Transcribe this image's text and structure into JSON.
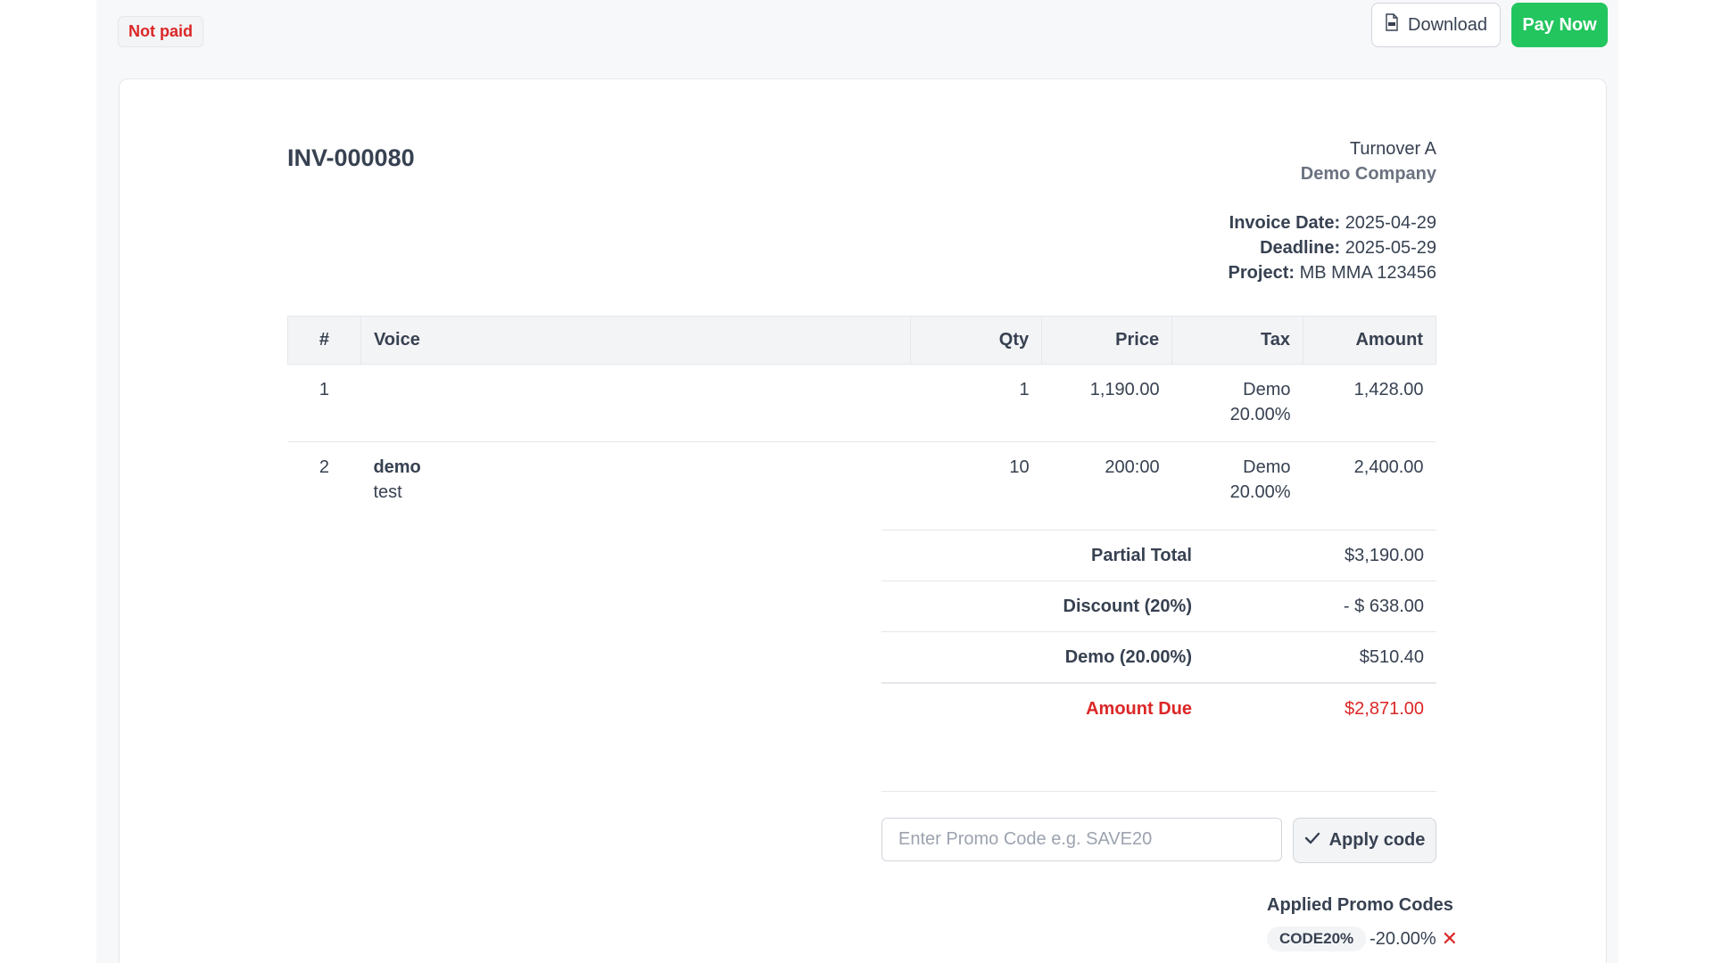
{
  "status_badge": "Not paid",
  "actions": {
    "download_label": "Download",
    "pay_label": "Pay Now"
  },
  "invoice": {
    "number": "INV-000080",
    "company_name": "Turnover A",
    "company_org": "Demo Company",
    "invoice_date_label": "Invoice Date:",
    "invoice_date": "2025-04-29",
    "deadline_label": "Deadline:",
    "deadline": "2025-05-29",
    "project_label": "Project:",
    "project": "MB MMA 123456"
  },
  "table": {
    "headers": [
      "#",
      "Voice",
      "Qty",
      "Price",
      "Tax",
      "Amount"
    ],
    "rows": [
      {
        "num": "1",
        "title": "",
        "desc": "",
        "qty": "1",
        "price": "1,190.00",
        "tax_name": "Demo",
        "tax_rate": "20.00%",
        "amount": "1,428.00"
      },
      {
        "num": "2",
        "title": "demo",
        "desc": "test",
        "qty": "10",
        "price": "200:00",
        "tax_name": "Demo",
        "tax_rate": "20.00%",
        "amount": "2,400.00"
      }
    ]
  },
  "totals": {
    "partial_label": "Partial Total",
    "partial_value": "$3,190.00",
    "discount_label": "Discount (20%)",
    "discount_value": "- $ 638.00",
    "tax_label": "Demo (20.00%)",
    "tax_value": "$510.40",
    "due_label": "Amount Due",
    "due_value": "$2,871.00"
  },
  "promo": {
    "placeholder": "Enter Promo Code e.g. SAVE20",
    "value": "",
    "apply_label": "Apply code",
    "applied_title": "Applied Promo Codes",
    "applied": [
      {
        "code": "CODE20%",
        "value": "-20.00%"
      }
    ]
  },
  "colors": {
    "accent_green": "#22c55e",
    "danger_red": "#dc2626",
    "text": "#374151"
  },
  "icons": {
    "download": "pdf-file-icon",
    "apply": "checkmark-icon",
    "remove": "close-icon"
  }
}
